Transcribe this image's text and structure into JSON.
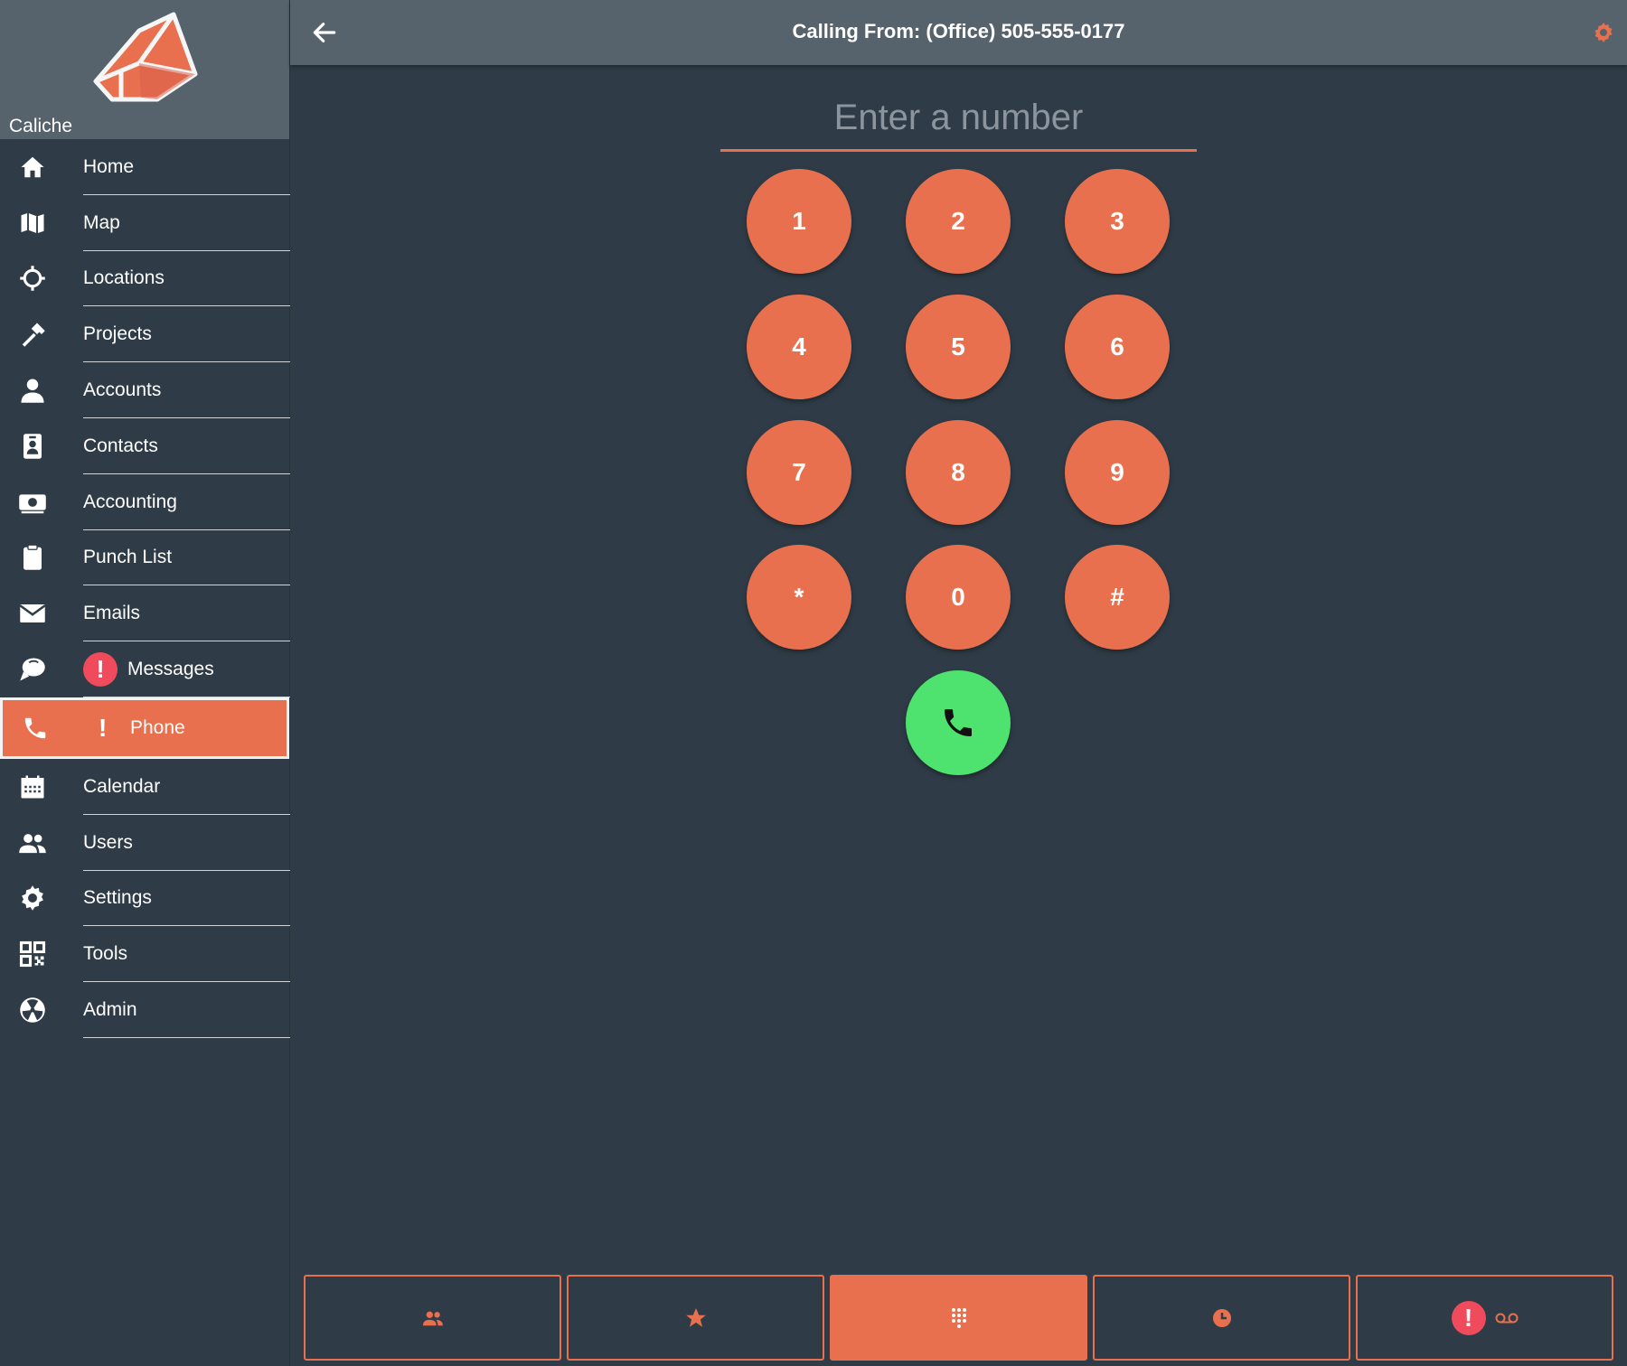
{
  "app": {
    "name": "Caliche"
  },
  "header": {
    "title": "Calling From: (Office) 505-555-0177"
  },
  "dialer": {
    "placeholder": "Enter a number",
    "value": "",
    "keys": [
      "1",
      "2",
      "3",
      "4",
      "5",
      "6",
      "7",
      "8",
      "9",
      "*",
      "0",
      "#"
    ]
  },
  "sidebar": {
    "items": [
      {
        "label": "Home",
        "icon": "home-icon"
      },
      {
        "label": "Map",
        "icon": "map-icon"
      },
      {
        "label": "Locations",
        "icon": "crosshair-icon"
      },
      {
        "label": "Projects",
        "icon": "hammer-icon"
      },
      {
        "label": "Accounts",
        "icon": "person-icon"
      },
      {
        "label": "Contacts",
        "icon": "id-badge-icon"
      },
      {
        "label": "Accounting",
        "icon": "money-icon"
      },
      {
        "label": "Punch List",
        "icon": "clipboard-icon"
      },
      {
        "label": "Emails",
        "icon": "envelope-icon"
      },
      {
        "label": "Messages",
        "icon": "chat-icon",
        "alert": "!"
      },
      {
        "label": "Phone",
        "icon": "phone-icon",
        "alert": "!",
        "active": true
      },
      {
        "label": "Calendar",
        "icon": "calendar-icon"
      },
      {
        "label": "Users",
        "icon": "users-icon"
      },
      {
        "label": "Settings",
        "icon": "gear-icon"
      },
      {
        "label": "Tools",
        "icon": "qrcode-icon"
      },
      {
        "label": "Admin",
        "icon": "admin-icon"
      }
    ]
  },
  "tabs": {
    "items": [
      {
        "icon": "contacts-tab-icon"
      },
      {
        "icon": "star-icon"
      },
      {
        "icon": "keypad-icon",
        "active": true
      },
      {
        "icon": "clock-icon"
      },
      {
        "icon": "voicemail-icon",
        "alert": "!"
      }
    ]
  },
  "colors": {
    "accent": "#e9704f",
    "call": "#4de36e",
    "alert": "#ef4b5c",
    "background": "#2f3c47",
    "header": "#56636d"
  }
}
